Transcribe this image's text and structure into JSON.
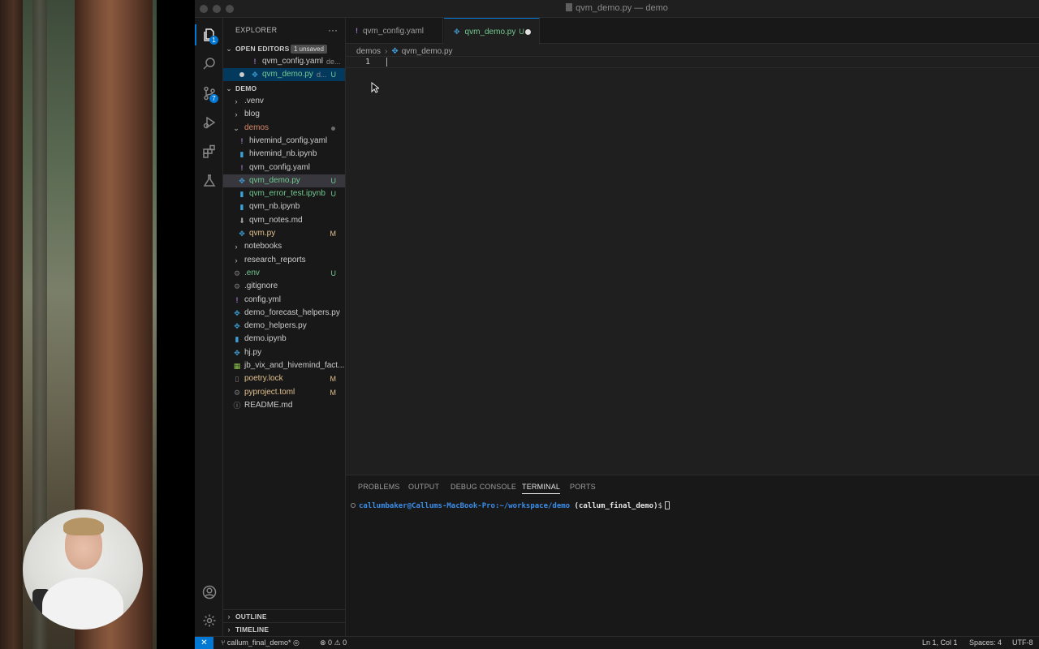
{
  "window": {
    "title": "qvm_demo.py — demo"
  },
  "activity": {
    "explorer_badge": "1",
    "scm_badge": "7"
  },
  "explorer": {
    "title": "EXPLORER",
    "more": "···",
    "open_editors": {
      "title": "OPEN EDITORS",
      "badge": "1 unsaved",
      "items": [
        {
          "name": "qvm_config.yaml",
          "desc": "de...",
          "icon": "yaml-icon"
        },
        {
          "name": "qvm_demo.py",
          "desc": "d...",
          "status": "U",
          "icon": "python-icon"
        }
      ]
    },
    "demo": {
      "title": "DEMO",
      "items": [
        {
          "name": ".venv",
          "kind": "folder",
          "level": 1
        },
        {
          "name": "blog",
          "kind": "folder",
          "level": 1
        },
        {
          "name": "demos",
          "kind": "folder-open",
          "level": 1
        },
        {
          "name": "hivemind_config.yaml",
          "kind": "yaml",
          "level": 2
        },
        {
          "name": "hivemind_nb.ipynb",
          "kind": "nb",
          "level": 2
        },
        {
          "name": "qvm_config.yaml",
          "kind": "yaml",
          "level": 2
        },
        {
          "name": "qvm_demo.py",
          "kind": "py",
          "level": 2,
          "status": "U"
        },
        {
          "name": "qvm_error_test.ipynb",
          "kind": "nb",
          "level": 2,
          "status": "U"
        },
        {
          "name": "qvm_nb.ipynb",
          "kind": "nb",
          "level": 2
        },
        {
          "name": "qvm_notes.md",
          "kind": "md",
          "level": 2
        },
        {
          "name": "qvm.py",
          "kind": "py",
          "level": 2,
          "status": "M"
        },
        {
          "name": "notebooks",
          "kind": "folder",
          "level": 1
        },
        {
          "name": "research_reports",
          "kind": "folder",
          "level": 1
        },
        {
          "name": ".env",
          "kind": "gear",
          "level": 1,
          "status": "U"
        },
        {
          "name": ".gitignore",
          "kind": "gear",
          "level": 1
        },
        {
          "name": "config.yml",
          "kind": "yaml",
          "level": 1
        },
        {
          "name": "demo_forecast_helpers.py",
          "kind": "py",
          "level": 1
        },
        {
          "name": "demo_helpers.py",
          "kind": "py",
          "level": 1
        },
        {
          "name": "demo.ipynb",
          "kind": "nb",
          "level": 1
        },
        {
          "name": "hj.py",
          "kind": "py",
          "level": 1
        },
        {
          "name": "jb_vix_and_hivemind_fact...",
          "kind": "csv",
          "level": 1
        },
        {
          "name": "poetry.lock",
          "kind": "lock",
          "level": 1,
          "status": "M"
        },
        {
          "name": "pyproject.toml",
          "kind": "gear",
          "level": 1,
          "status": "M"
        },
        {
          "name": "README.md",
          "kind": "info",
          "level": 1
        }
      ]
    },
    "outline": "OUTLINE",
    "timeline": "TIMELINE"
  },
  "tabs": [
    {
      "name": "qvm_config.yaml"
    },
    {
      "name": "qvm_demo.py",
      "status": "U"
    }
  ],
  "breadcrumb": {
    "folder": "demos",
    "file": "qvm_demo.py"
  },
  "editor": {
    "line_number": "1"
  },
  "panel": {
    "tabs": [
      "PROBLEMS",
      "OUTPUT",
      "DEBUG CONSOLE",
      "TERMINAL",
      "PORTS"
    ],
    "active_tab": "TERMINAL",
    "terminal": {
      "user_host": "callumbaker@Callums-MacBook-Pro",
      "path": ":~/workspace/demo",
      "env": "(callum_final_demo)",
      "prompt": "$"
    }
  },
  "statusbar": {
    "branch": "callum_final_demo*",
    "errors": "0",
    "warnings": "0",
    "position": "Ln 1, Col 1",
    "spaces": "Spaces: 4",
    "encoding": "UTF-8"
  }
}
